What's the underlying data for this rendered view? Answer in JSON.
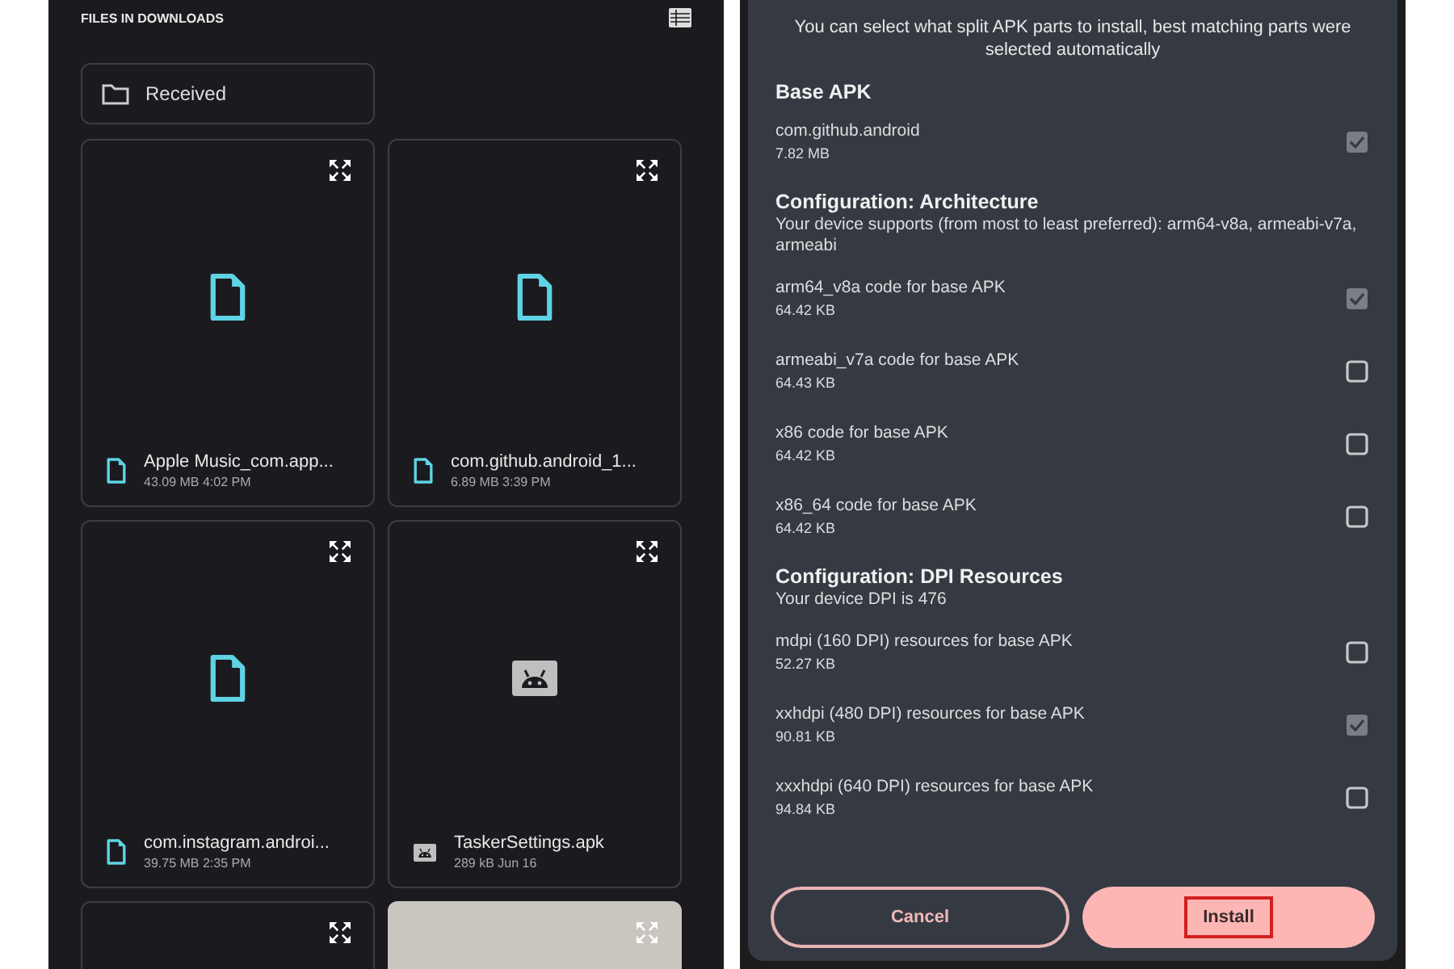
{
  "files_panel": {
    "title": "FILES IN DOWNLOADS",
    "folders": [
      {
        "name": "Received"
      }
    ],
    "files": [
      {
        "kind": "file",
        "name": "Apple Music_com.app...",
        "meta": "43.09 MB 4:02 PM"
      },
      {
        "kind": "file",
        "name": "com.github.android_1...",
        "meta": "6.89 MB 3:39 PM"
      },
      {
        "kind": "file",
        "name": "com.instagram.androi...",
        "meta": "39.75 MB 2:35 PM"
      },
      {
        "kind": "apk",
        "name": "TaskerSettings.apk",
        "meta": "289 kB Jun 16"
      },
      {
        "kind": "blank"
      },
      {
        "kind": "photo"
      }
    ]
  },
  "install_dialog": {
    "intro": "You can select what split APK parts to install, best matching parts were selected automatically",
    "sections": [
      {
        "title": "Base APK",
        "items": [
          {
            "name": "com.github.android",
            "size": "7.82 MB",
            "checked": true,
            "disabled": true
          }
        ]
      },
      {
        "title": "Configuration: Architecture",
        "description": "Your device supports (from most to least preferred): arm64-v8a, armeabi-v7a, armeabi",
        "items": [
          {
            "name": "arm64_v8a code for base APK",
            "size": "64.42 KB",
            "checked": true,
            "disabled": true
          },
          {
            "name": "armeabi_v7a code for base APK",
            "size": "64.43 KB",
            "checked": false,
            "disabled": false
          },
          {
            "name": "x86 code for base APK",
            "size": "64.42 KB",
            "checked": false,
            "disabled": false
          },
          {
            "name": "x86_64 code for base APK",
            "size": "64.42 KB",
            "checked": false,
            "disabled": false
          }
        ]
      },
      {
        "title": "Configuration: DPI Resources",
        "description": "Your device DPI is 476",
        "items": [
          {
            "name": "mdpi (160 DPI) resources for base APK",
            "size": "52.27 KB",
            "checked": false,
            "disabled": false
          },
          {
            "name": "xxhdpi (480 DPI) resources for base APK",
            "size": "90.81 KB",
            "checked": true,
            "disabled": true
          },
          {
            "name": "xxxhdpi (640 DPI) resources for base APK",
            "size": "94.84 KB",
            "checked": false,
            "disabled": false
          }
        ]
      }
    ],
    "buttons": [
      {
        "kind": "outline",
        "label": "Cancel",
        "highlighted": false
      },
      {
        "kind": "filled",
        "label": "Install",
        "highlighted": true
      }
    ]
  }
}
